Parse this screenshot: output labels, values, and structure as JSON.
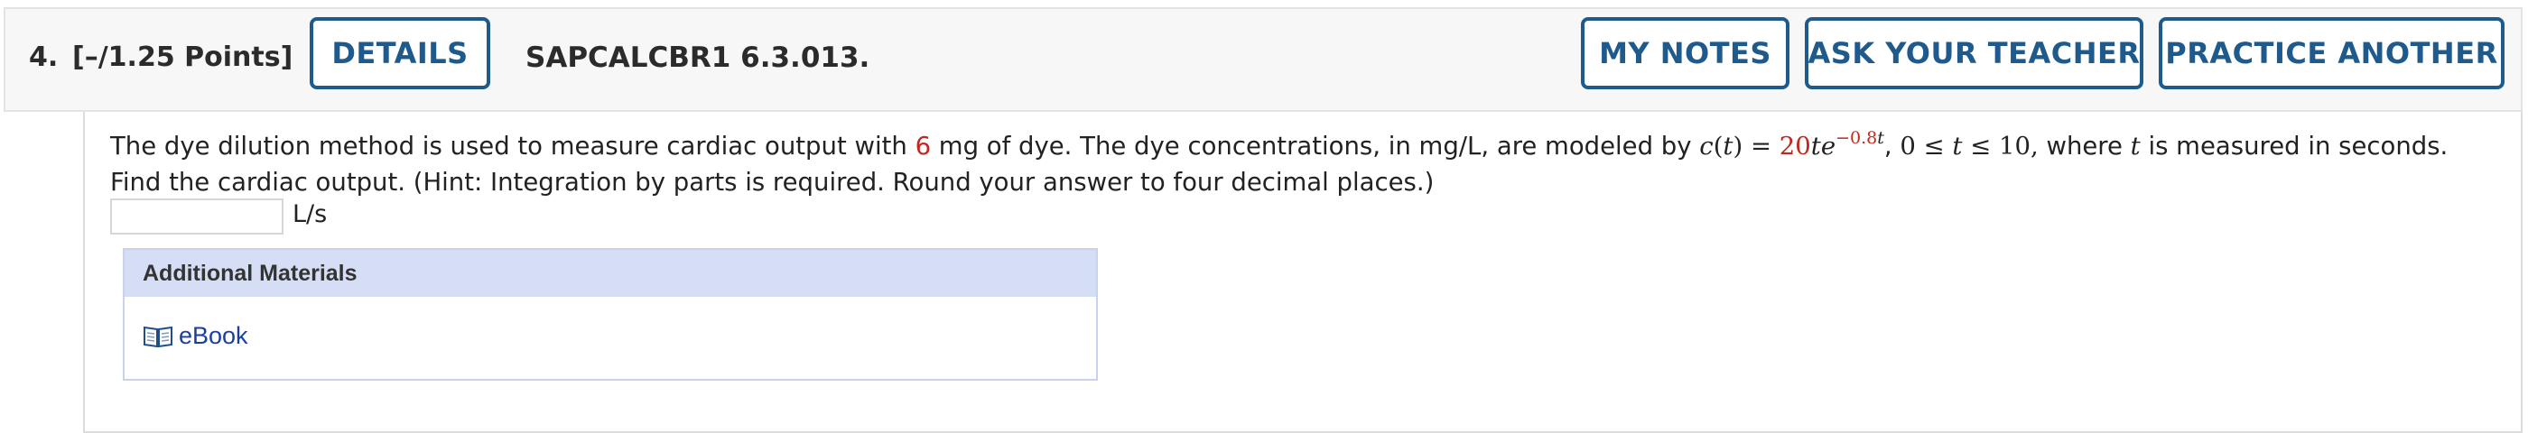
{
  "header": {
    "question_number": "4.",
    "points": "[–/1.25 Points]",
    "details_label": "DETAILS",
    "code": "SAPCALCBR1 6.3.013.",
    "my_notes_label": "MY NOTES",
    "ask_teacher_label": "ASK YOUR TEACHER",
    "practice_label": "PRACTICE ANOTHER"
  },
  "question": {
    "text_1": "The dye dilution method is used to measure cardiac output with ",
    "dose": "6",
    "text_2": " mg of dye. The dye concentrations, in mg/L, are modeled by  ",
    "func_c": "c",
    "func_paren_open": "(",
    "func_t": "t",
    "func_paren_close_eq": ") = ",
    "coef": "20",
    "var_t": "t",
    "e": "e",
    "exponent_value": "−0.8",
    "exponent_var": "t",
    "comma": ",   ",
    "domain_start": "0 ≤ ",
    "domain_t": "t",
    "domain_end": " ≤ 10,",
    "text_3": "  where ",
    "where_t": "t",
    "text_4": " is measured in seconds. Find the cardiac output. (Hint: Integration by parts is required. Round your answer to four decimal places.)"
  },
  "answer": {
    "value": "",
    "unit": "L/s"
  },
  "materials": {
    "heading": "Additional Materials",
    "ebook_icon": "book-icon",
    "ebook_label": "eBook"
  },
  "colors": {
    "accent": "#1f5a8c",
    "highlight": "#c0281f",
    "link": "#1a3fa3",
    "materials_header": "#d6def5"
  }
}
